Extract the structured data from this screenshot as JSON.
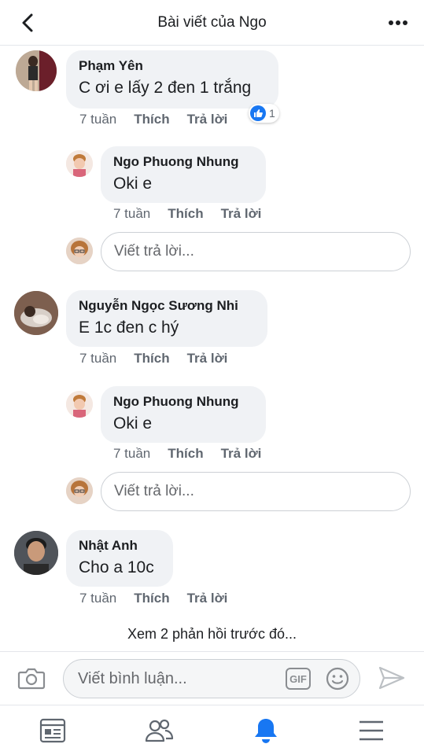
{
  "header": {
    "title": "Bài viết của Ngo"
  },
  "comments": [
    {
      "author": "Phạm Yên",
      "text": "C ơi e lấy 2 đen 1 trắng",
      "time": "7 tuần",
      "like_label": "Thích",
      "reply_label": "Trả lời",
      "reaction_count": "1"
    },
    {
      "author": "Ngo Phuong Nhung",
      "text": "Oki e",
      "time": "7 tuần",
      "like_label": "Thích",
      "reply_label": "Trả lời"
    },
    {
      "author": "Nguyễn Ngọc Sương Nhi",
      "text": "E 1c đen c hý",
      "time": "7 tuần",
      "like_label": "Thích",
      "reply_label": "Trả lời"
    },
    {
      "author": "Ngo Phuong Nhung",
      "text": "Oki e",
      "time": "7 tuần",
      "like_label": "Thích",
      "reply_label": "Trả lời"
    },
    {
      "author": "Nhật Anh",
      "text": "Cho a 10c",
      "time": "7 tuần",
      "like_label": "Thích",
      "reply_label": "Trả lời"
    }
  ],
  "reply_placeholder": "Viết trả lời...",
  "more_replies": "Xem 2 phản hồi trước đó...",
  "composer": {
    "placeholder": "Viết bình luận...",
    "gif_label": "GIF"
  },
  "colors": {
    "accent": "#1877f2",
    "bubble": "#f0f2f5",
    "meta": "#606770"
  },
  "icons": {
    "back": "chevron-left-icon",
    "more": "more-dots-icon",
    "camera": "camera-icon",
    "emoji": "smiley-icon",
    "send": "send-icon",
    "tabs": [
      "news-feed-icon",
      "friends-icon",
      "notifications-bell-icon",
      "menu-icon"
    ]
  }
}
